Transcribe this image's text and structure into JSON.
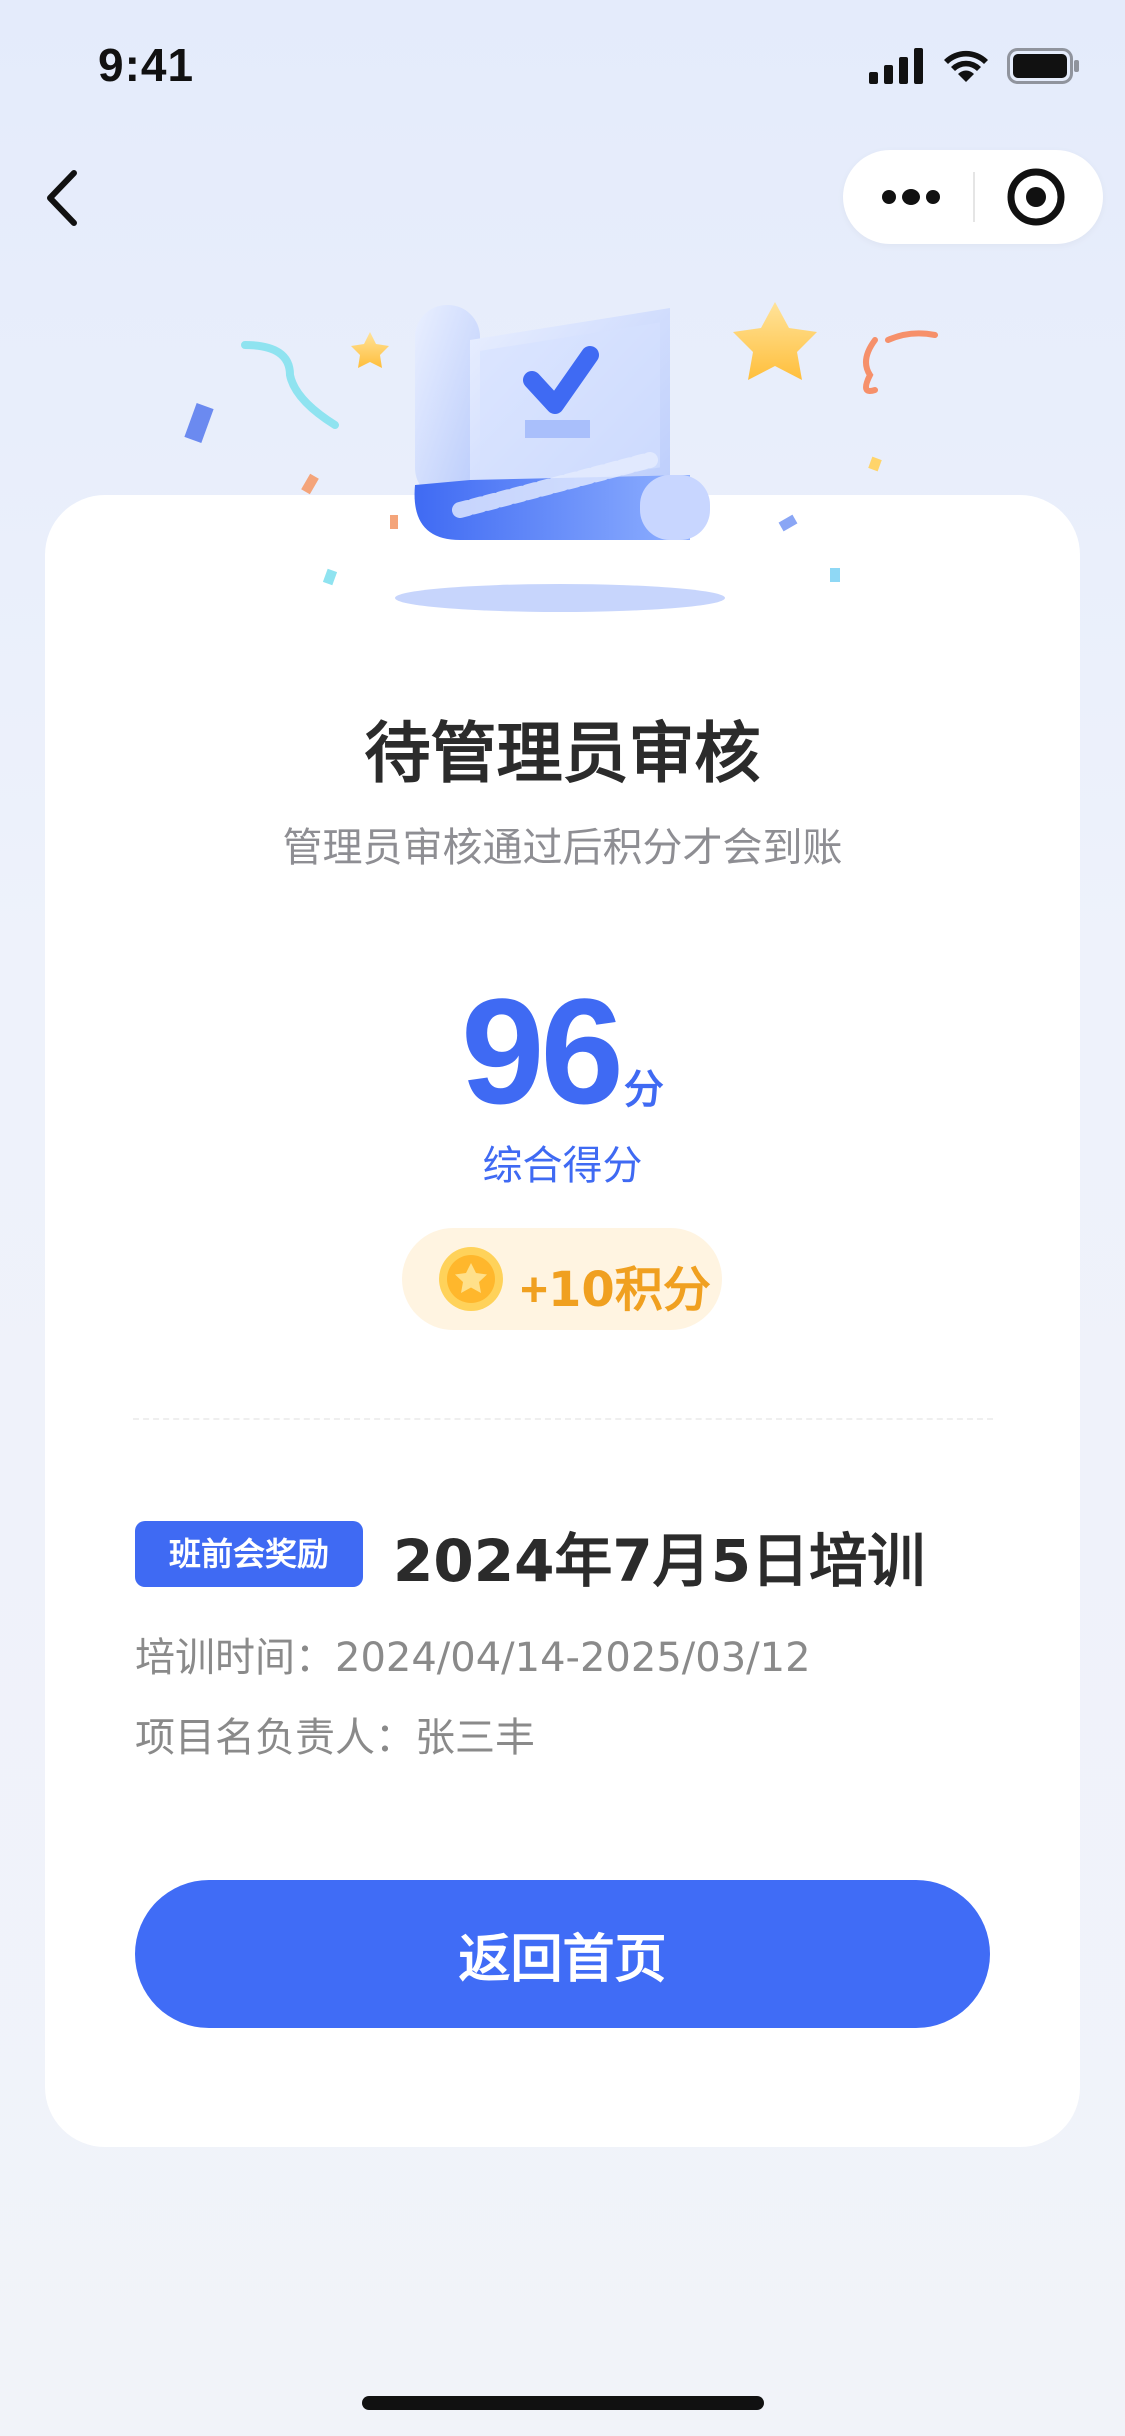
{
  "status_bar": {
    "time": "9:41"
  },
  "nav": {
    "back_icon": "chevron-left-icon",
    "more_icon": "more-dots-icon",
    "close_icon": "target-circle-icon"
  },
  "review": {
    "title": "待管理员审核",
    "subtitle": "管理员审核通过后积分才会到账"
  },
  "score": {
    "value": "96",
    "unit": "分",
    "label": "综合得分"
  },
  "reward": {
    "plus": "+",
    "amount": "10",
    "unit": "积分",
    "icon": "coin-star-icon"
  },
  "training": {
    "tag": "班前会奖励",
    "title": "2024年7月5日培训",
    "time_label": "培训时间：",
    "time_value": "2024/04/14-2025/03/12",
    "owner_label": "项目名负责人：",
    "owner_value": "张三丰"
  },
  "actions": {
    "home_button": "返回首页"
  },
  "colors": {
    "primary": "#406cf6",
    "reward": "#f0a020",
    "reward_bg": "#fff4e1"
  }
}
